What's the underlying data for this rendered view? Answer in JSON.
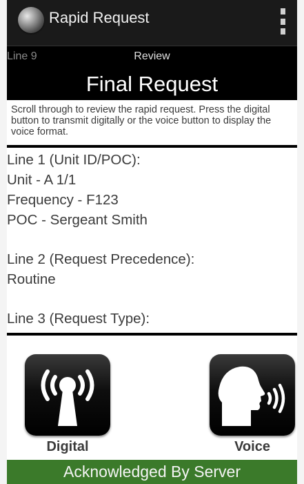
{
  "actionbar": {
    "title": "Rapid Request",
    "app_icon": "globe-icon",
    "menu_icon": "overflow-menu-icon"
  },
  "subheader": {
    "line": "Line 9",
    "step": "Review"
  },
  "page": {
    "title": "Final Request"
  },
  "instructions": "Scroll through to review the rapid request. Press the digital button to transmit digitally or the voice button to display the voice format.",
  "request": {
    "line1": {
      "heading": "Line 1 (Unit ID/POC):",
      "lines": [
        "Unit - A 1/1",
        "Frequency - F123",
        "POC - Sergeant Smith"
      ]
    },
    "line2": {
      "heading": "Line 2 (Request Precedence):",
      "lines": [
        "Routine"
      ]
    },
    "line3": {
      "heading": "Line 3 (Request Type):"
    }
  },
  "buttons": {
    "digital": {
      "label": "Digital",
      "icon": "radio-tower-icon"
    },
    "voice": {
      "label": "Voice",
      "icon": "speaking-head-icon"
    }
  },
  "status": {
    "text": "Acknowledged By Server",
    "color": "#3b7a2a"
  }
}
